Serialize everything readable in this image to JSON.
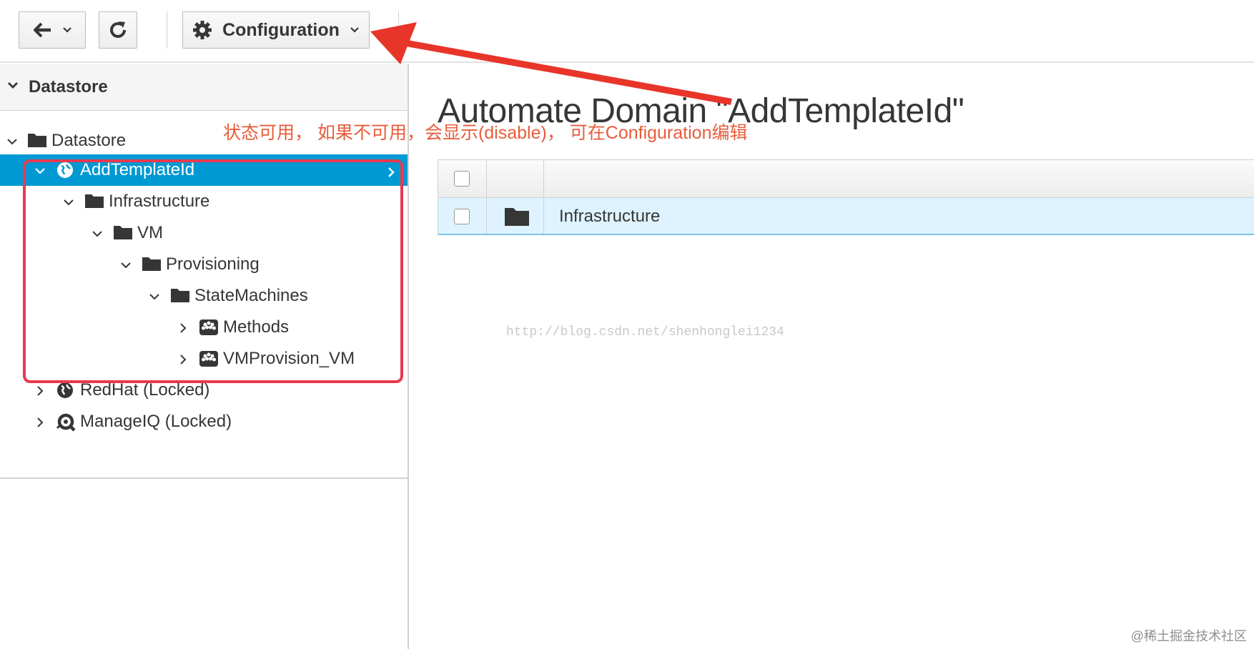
{
  "toolbar": {
    "configuration_label": "Configuration",
    "icons": [
      "arrow-left-icon",
      "chevron-down-icon",
      "refresh-icon",
      "gear-icon"
    ]
  },
  "sidebar": {
    "accordion_title": "Datastore",
    "tree": [
      {
        "label": "Datastore",
        "icon": "folder-icon",
        "expanded": true
      },
      {
        "label": "AddTemplateId",
        "icon": "globe-icon",
        "expanded": true,
        "selected": true
      },
      {
        "label": "Infrastructure",
        "icon": "folder-icon",
        "expanded": true
      },
      {
        "label": "VM",
        "icon": "folder-icon",
        "expanded": true
      },
      {
        "label": "Provisioning",
        "icon": "folder-icon",
        "expanded": true
      },
      {
        "label": "StateMachines",
        "icon": "folder-icon",
        "expanded": true
      },
      {
        "label": "Methods",
        "icon": "class-icon",
        "expanded": false
      },
      {
        "label": "VMProvision_VM",
        "icon": "class-icon",
        "expanded": false
      },
      {
        "label": "RedHat (Locked)",
        "icon": "globe-icon",
        "expanded": false
      },
      {
        "label": "ManageIQ (Locked)",
        "icon": "manageiq-icon",
        "expanded": false
      }
    ]
  },
  "main": {
    "title": "Automate Domain \"AddTemplateId\"",
    "table": {
      "rows": [
        {
          "name": "Infrastructure",
          "icon": "folder-icon"
        }
      ]
    }
  },
  "annotation": {
    "note": "状态可用， 如果不可用，会显示(disable)， 可在Configuration编辑",
    "color": "#e85c3a",
    "box_color": "#e8394f",
    "arrow_color": "#e8352a"
  },
  "watermark": "http://blog.csdn.net/shenhonglei1234",
  "corner_mark": "@稀土掘金技术社区",
  "colors": {
    "selected_bg": "#0099d3",
    "row_highlight": "#def3ff"
  }
}
